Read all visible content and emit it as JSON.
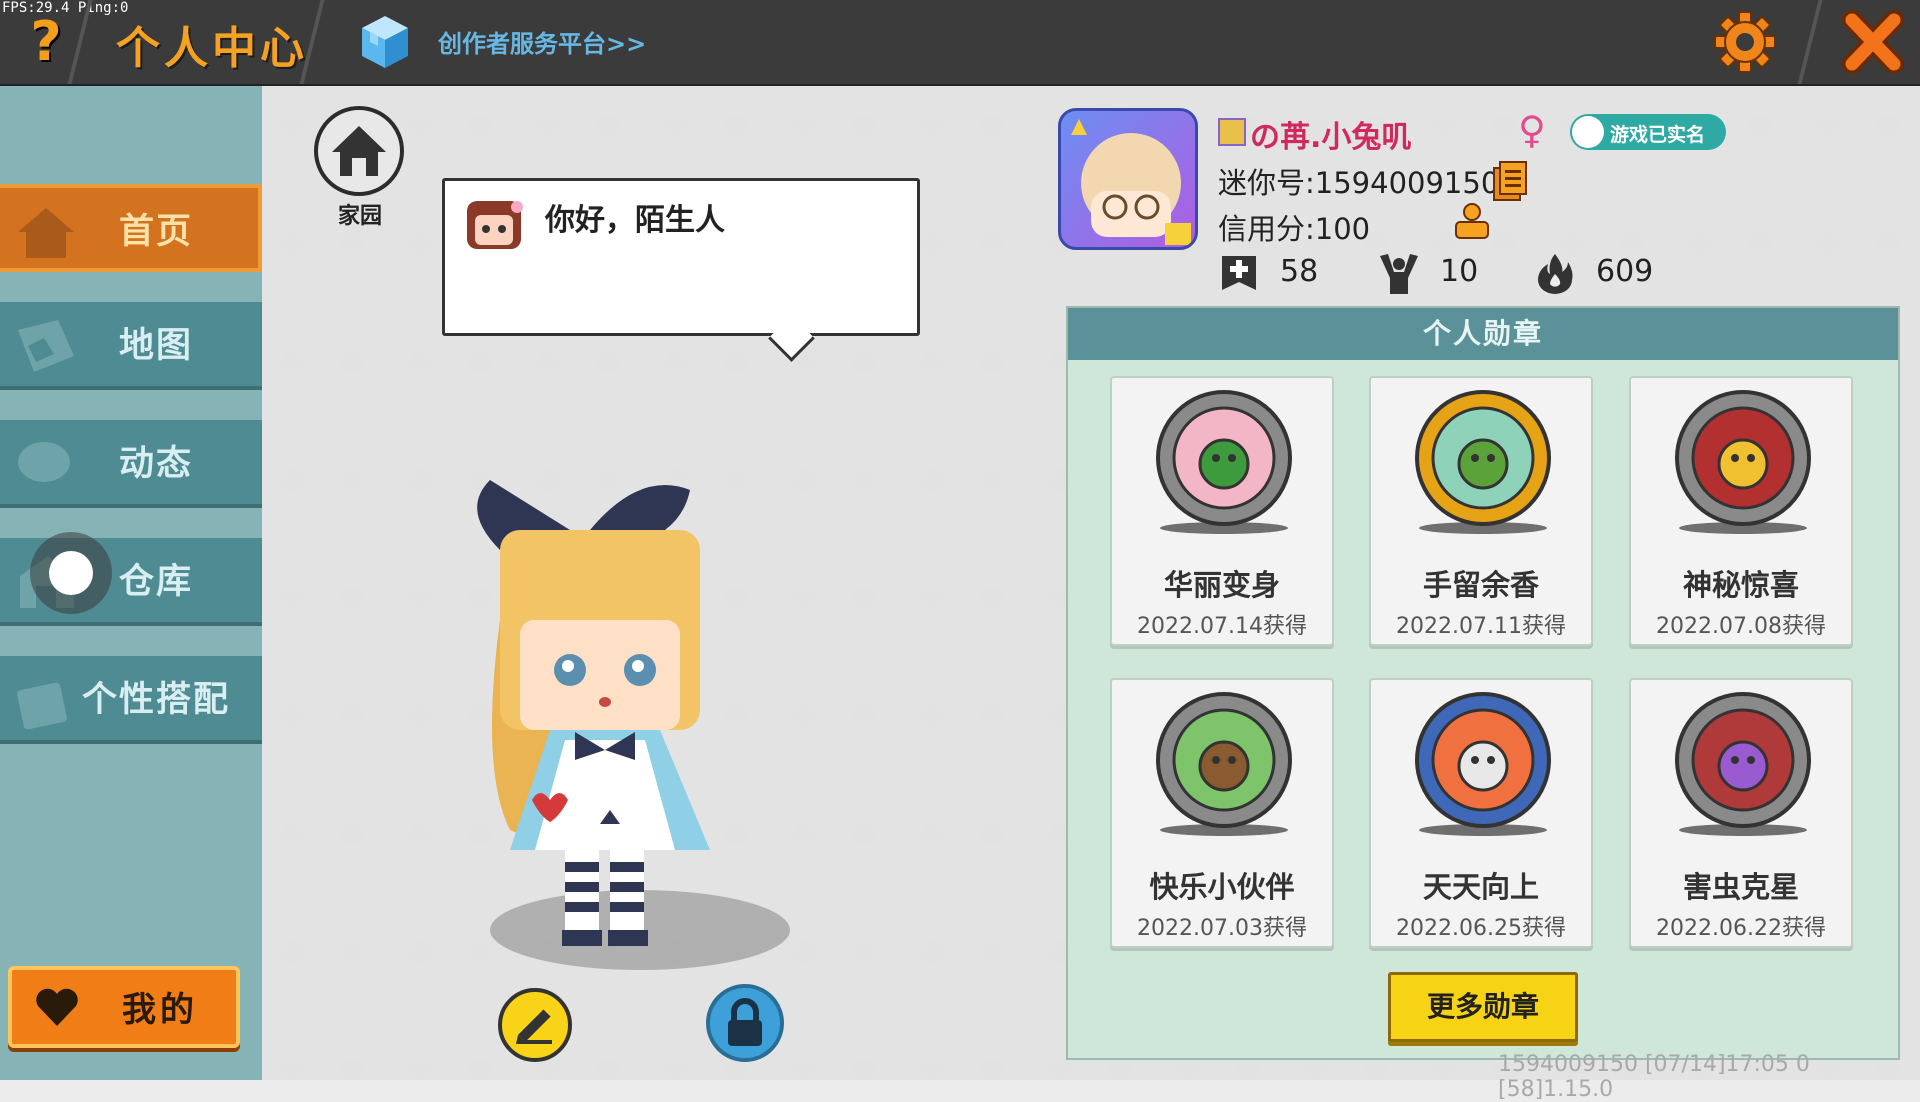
{
  "topbar": {
    "fps": "FPS:29.4  Ping:0",
    "help_icon": "question-mark-icon",
    "title": "个人中心",
    "creator_link": "创作者服务平台>>",
    "settings_icon": "gear-icon",
    "close_icon": "close-x-icon",
    "accent": "#f5a122"
  },
  "sidebar": {
    "items": [
      {
        "label": "首页",
        "icon": "house-icon",
        "active": true
      },
      {
        "label": "地图",
        "icon": "map-icon",
        "active": false
      },
      {
        "label": "动态",
        "icon": "feed-icon",
        "active": false
      },
      {
        "label": "仓库",
        "icon": "warehouse-icon",
        "active": false
      },
      {
        "label": "个性搭配",
        "icon": "outfit-icon",
        "active": false
      }
    ],
    "mine_label": "我的",
    "mine_icon": "heart-icon"
  },
  "home": {
    "label": "家园",
    "icon": "home-icon"
  },
  "bubble": {
    "text": "你好，陌生人"
  },
  "profile": {
    "nickname": "の苒.小兔叽",
    "gender_symbol": "♀",
    "realname_badge": "游戏已实名",
    "uid_text": "迷你号:1594009150",
    "credit_text": "信用分:100",
    "stats": [
      {
        "icon": "plus-card-icon",
        "value": "58"
      },
      {
        "icon": "cheer-icon",
        "value": "10"
      },
      {
        "icon": "flame-icon",
        "value": "609"
      }
    ]
  },
  "medals": {
    "header": "个人勋章",
    "items": [
      {
        "name": "华丽变身",
        "date": "2022.07.14获得",
        "icon": "dino-mirror-medal-icon"
      },
      {
        "name": "手留余香",
        "date": "2022.07.11获得",
        "icon": "flower-frog-medal-icon"
      },
      {
        "name": "神秘惊喜",
        "date": "2022.07.08获得",
        "icon": "gift-box-medal-icon"
      },
      {
        "name": "快乐小伙伴",
        "date": "2022.07.03获得",
        "icon": "friends-medal-icon"
      },
      {
        "name": "天天向上",
        "date": "2022.06.25获得",
        "icon": "calendar-medal-icon"
      },
      {
        "name": "害虫克星",
        "date": "2022.06.22获得",
        "icon": "bug-net-medal-icon"
      }
    ],
    "more_button": "更多勋章"
  },
  "footer": {
    "text": "1594009150   [07/14]17:05 0  [58]1.15.0"
  }
}
